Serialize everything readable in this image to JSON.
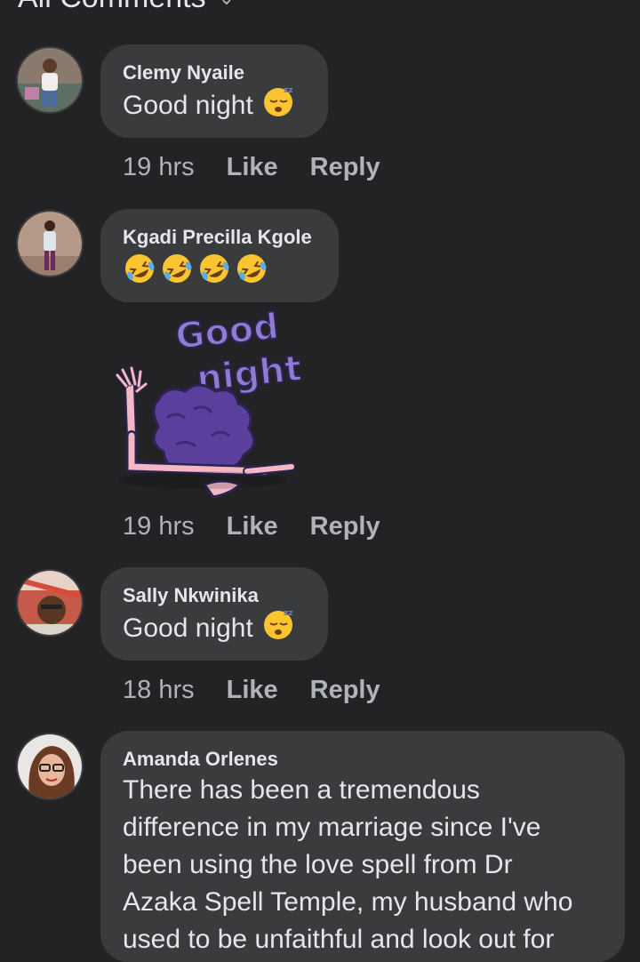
{
  "header": {
    "title": "All Comments"
  },
  "comments": [
    {
      "name": "Clemy Nyaile",
      "text": "Good night",
      "time": "19 hrs",
      "like": "Like",
      "reply": "Reply"
    },
    {
      "name": "Kgadi Precilla Kgole",
      "time": "19 hrs",
      "like": "Like",
      "reply": "Reply",
      "sticker": {
        "line1": "Good",
        "line2": "night"
      }
    },
    {
      "name": "Sally Nkwinika",
      "text": "Good night",
      "time": "18 hrs",
      "like": "Like",
      "reply": "Reply"
    },
    {
      "name": "Amanda Orlenes",
      "lines": [
        "There has been a tremendous",
        "difference in my marriage since I've",
        "been using the love spell from Dr",
        "Azaka Spell Temple, my husband who",
        "used to be unfaithful and look out for"
      ]
    }
  ],
  "icons": {
    "header_chevron": "chevron-down-icon",
    "sleeping_emoji": "sleeping-face-emoji",
    "laughing_emoji": "rolling-on-floor-laughing-emoji"
  },
  "colors": {
    "background": "#232325",
    "bubble": "#3a3b3c",
    "text": "#e4e6eb",
    "meta": "#b0b3b8"
  }
}
